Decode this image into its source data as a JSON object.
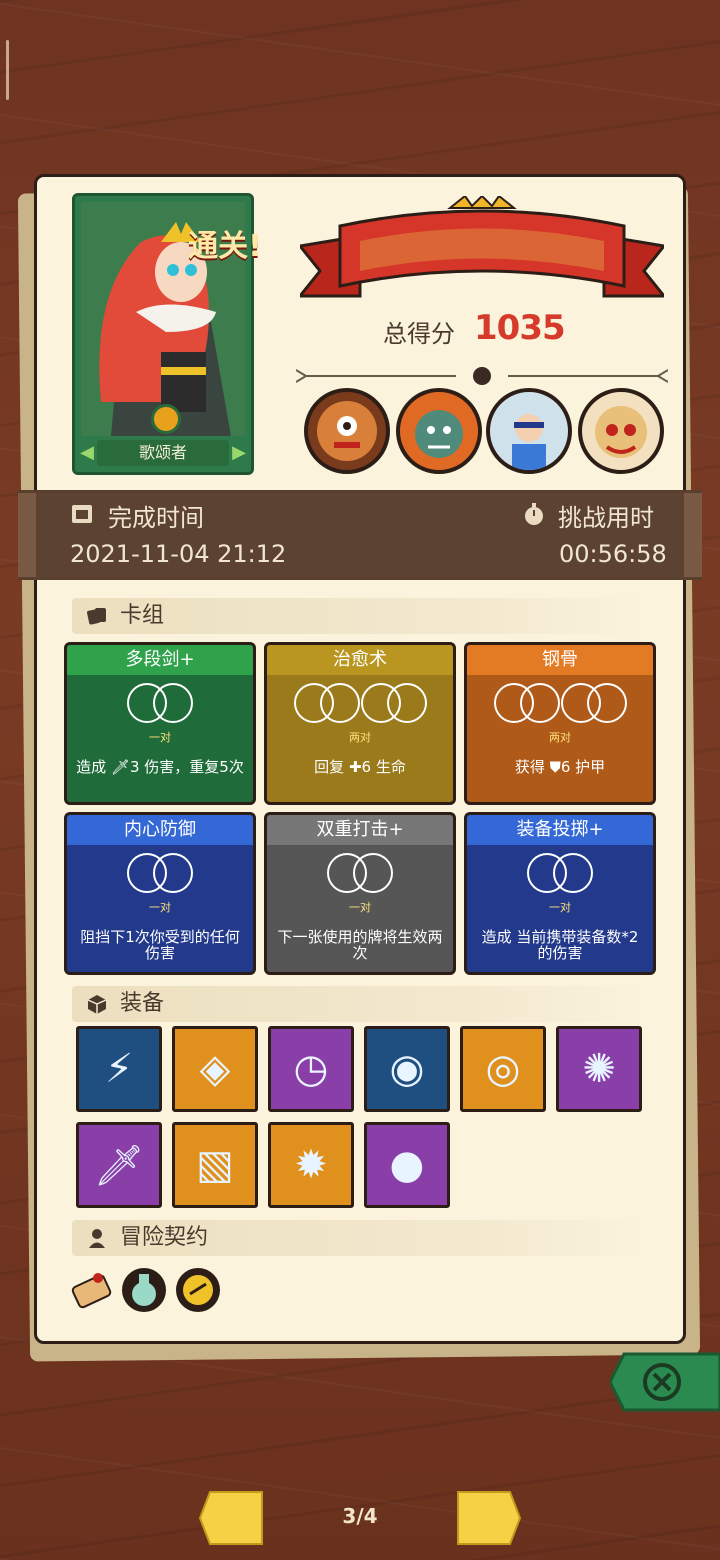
{
  "hero": {
    "name": "歌颂者"
  },
  "result": {
    "banner": "通关!",
    "score_label": "总得分",
    "score": "1035"
  },
  "time": {
    "finish_label": "完成时间",
    "finish_value": "2021-11-04 21:12",
    "duration_label": "挑战用时",
    "duration_value": "00:56:58"
  },
  "deck": {
    "title": "卡组",
    "cards": [
      {
        "name": "多段剑+",
        "pair": "一对",
        "desc": "造成 🗡3 伤害，重复5次",
        "rings": 1,
        "color": "#1f6b3a",
        "head": "#2fa24b"
      },
      {
        "name": "治愈术",
        "pair": "两对",
        "desc": "回复 ✚6 生命",
        "rings": 2,
        "color": "#9b7a1c",
        "head": "#b8961f"
      },
      {
        "name": "钢骨",
        "pair": "两对",
        "desc": "获得 ⛊6 护甲",
        "rings": 2,
        "color": "#b05a1a",
        "head": "#e37a24"
      },
      {
        "name": "内心防御",
        "pair": "一对",
        "desc": "阻挡下1次你受到的任何伤害",
        "rings": 1,
        "color": "#233a8c",
        "head": "#3468d6"
      },
      {
        "name": "双重打击+",
        "pair": "一对",
        "desc": "下一张使用的牌将生效两次",
        "rings": 1,
        "color": "#565656",
        "head": "#777777"
      },
      {
        "name": "装备投掷+",
        "pair": "一对",
        "desc": "造成 当前携带装备数*2 的伤害",
        "rings": 1,
        "color": "#233a8c",
        "head": "#3468d6"
      }
    ]
  },
  "equipment": {
    "title": "装备",
    "items": [
      {
        "icon": "lightning-orb-icon",
        "bg": "#1f4f80"
      },
      {
        "icon": "ice-shield-icon",
        "bg": "#e0901c"
      },
      {
        "icon": "clock-necklace-icon",
        "bg": "#8a3fa8"
      },
      {
        "icon": "eye-ring-icon",
        "bg": "#1f4f80"
      },
      {
        "icon": "water-amulet-icon",
        "bg": "#e0901c"
      },
      {
        "icon": "spiked-shield-icon",
        "bg": "#8a3fa8"
      },
      {
        "icon": "dagger-icon",
        "bg": "#8a3fa8"
      },
      {
        "icon": "moss-stone-icon",
        "bg": "#e0901c"
      },
      {
        "icon": "spiked-ball-icon",
        "bg": "#e0901c"
      },
      {
        "icon": "blue-spirit-icon",
        "bg": "#8a3fa8"
      }
    ]
  },
  "contracts": {
    "title": "冒险契约",
    "items": [
      "scroll-icon",
      "potion-icon",
      "coin-icon"
    ]
  },
  "nav": {
    "page": "3/4"
  }
}
